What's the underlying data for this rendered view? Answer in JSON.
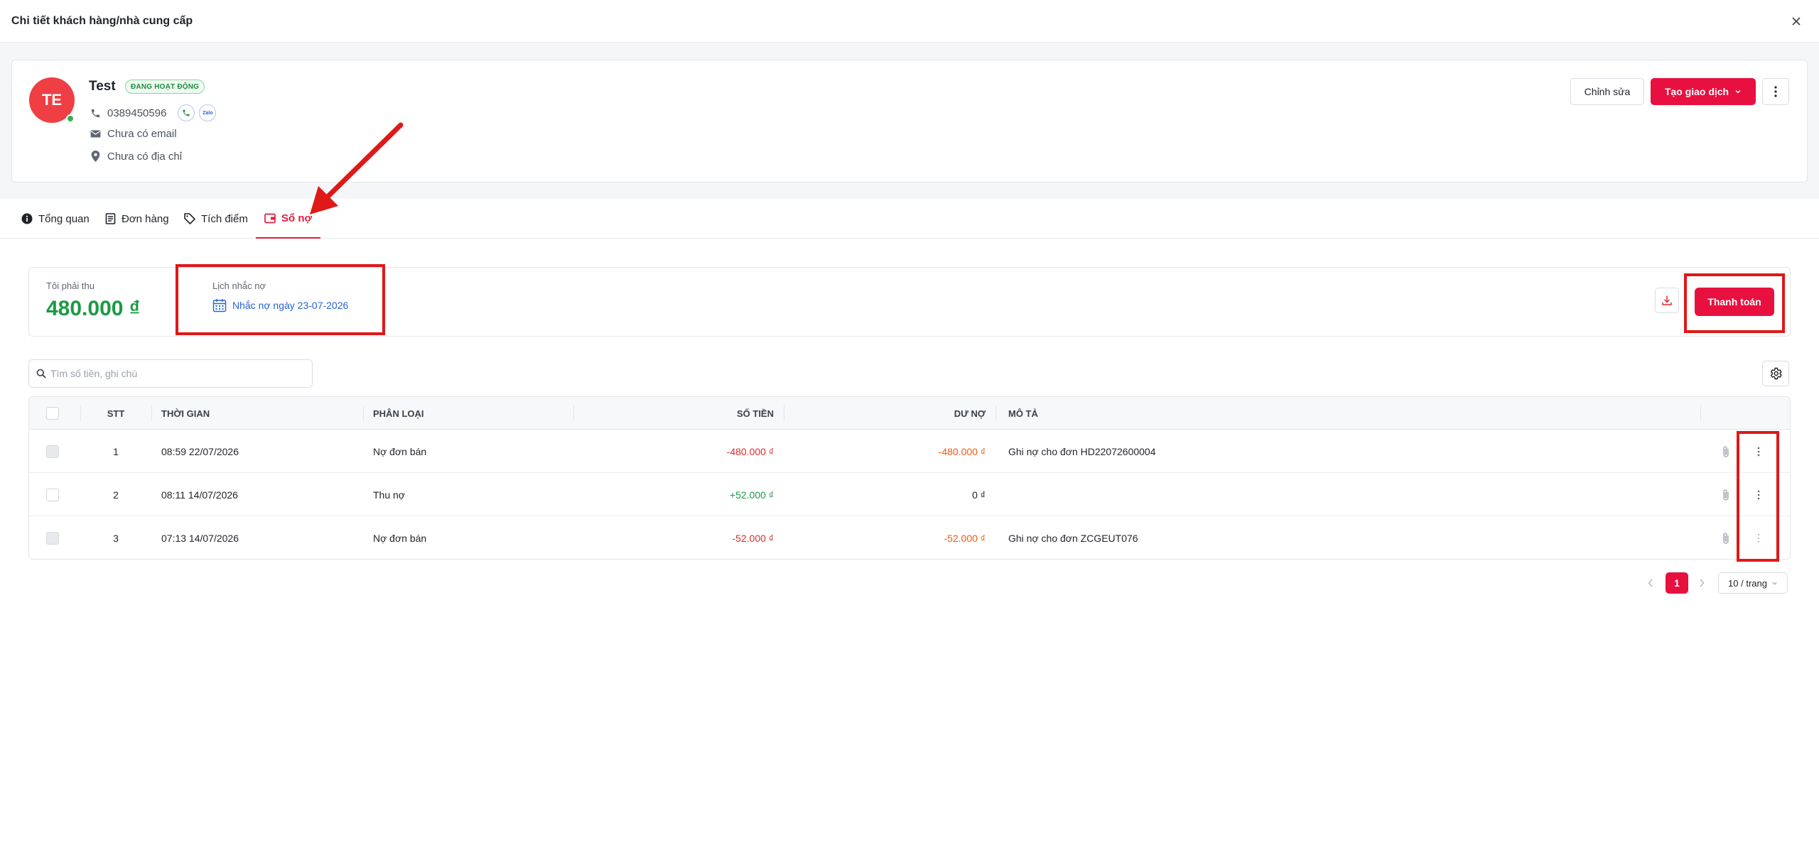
{
  "modal": {
    "title": "Chi tiết khách hàng/nhà cung cấp"
  },
  "customer": {
    "initials": "TE",
    "name": "Test",
    "status": "ĐANG HOẠT ĐỘNG",
    "phone": "0389450596",
    "zalo_label": "Zalo",
    "email": "Chưa có email",
    "address": "Chưa có địa chỉ"
  },
  "actions": {
    "edit": "Chỉnh sửa",
    "create": "Tạo giao dịch"
  },
  "tabs": [
    {
      "label": "Tổng quan",
      "icon": "info-icon"
    },
    {
      "label": "Đơn hàng",
      "icon": "receipt-icon"
    },
    {
      "label": "Tích điểm",
      "icon": "tag-icon"
    },
    {
      "label": "Sổ nợ",
      "icon": "wallet-icon",
      "active": true
    }
  ],
  "summary": {
    "receivable_label": "Tôi phải thu",
    "receivable_amount": "480.000 ₫",
    "reminder_label": "Lịch nhắc nợ",
    "reminder_link": "Nhắc nợ ngày 23-07-2026",
    "pay_button": "Thanh toán"
  },
  "search": {
    "placeholder": "Tìm số tiền, ghi chú"
  },
  "table": {
    "headers": {
      "stt": "STT",
      "time": "THỜI GIAN",
      "type": "PHÂN LOẠI",
      "amount": "SỐ TIỀN",
      "balance": "DƯ NỢ",
      "desc": "MÔ TẢ"
    },
    "rows": [
      {
        "stt": "1",
        "time": "08:59 22/07/2026",
        "type": "Nợ đơn bán",
        "amount": "-480.000 ₫",
        "balance": "-480.000 ₫",
        "desc": "Ghi nợ cho đơn HD22072600004"
      },
      {
        "stt": "2",
        "time": "08:11 14/07/2026",
        "type": "Thu nợ",
        "amount": "+52.000 ₫",
        "balance": "0 ₫",
        "desc": ""
      },
      {
        "stt": "3",
        "time": "07:13 14/07/2026",
        "type": "Nợ đơn bán",
        "amount": "-52.000 ₫",
        "balance": "-52.000 ₫",
        "desc": "Ghi nợ cho đơn ZCGEUT076"
      }
    ]
  },
  "pagination": {
    "current": "1",
    "page_size": "10 / trang"
  },
  "colors": {
    "primary": "#e8103f",
    "positive": "#1b9a44",
    "negative": "#e02b2b",
    "annotation": "#e01818"
  }
}
